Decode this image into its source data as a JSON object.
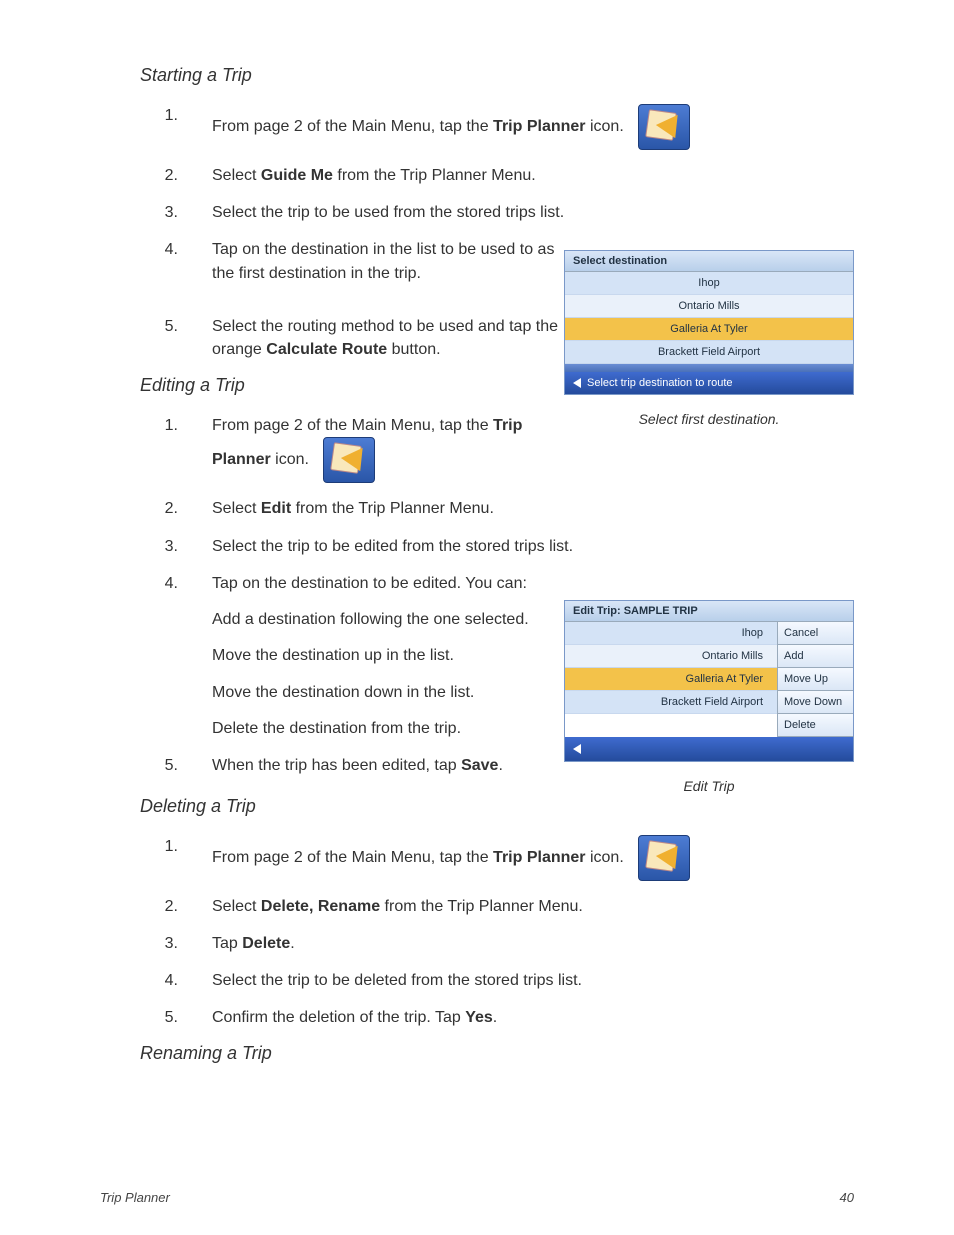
{
  "sections": {
    "starting": {
      "heading": "Starting a Trip",
      "steps": {
        "s1a": "From page 2 of the Main Menu, tap the ",
        "s1b": "Trip Planner",
        "s1c": " icon.",
        "s2a": "Select ",
        "s2b": "Guide Me",
        "s2c": " from the Trip Planner Menu.",
        "s3": "Select the trip to be used from the stored trips list.",
        "s4": "Tap on the destination in the list to be used to as the first destination in the trip.",
        "s5a": "Select the routing method to be used and tap the orange ",
        "s5b": "Calculate Route",
        "s5c": " button."
      }
    },
    "editing": {
      "heading": "Editing a Trip",
      "steps": {
        "s1a": "From page 2 of the Main Menu, tap the ",
        "s1b": "Trip Planner",
        "s1c": " icon.",
        "s2a": "Select ",
        "s2b": "Edit",
        "s2c": " from the Trip Planner Menu.",
        "s3": "Select the trip to be edited from the stored trips list.",
        "s4": "Tap on the destination to be edited.  You can:",
        "sub1": "Add a destination following the one selected.",
        "sub2": "Move the destination up in the list.",
        "sub3": "Move the destination down in the list.",
        "sub4": "Delete the destination from the trip.",
        "s5a": "When the trip has been edited, tap ",
        "s5b": "Save",
        "s5c": "."
      }
    },
    "deleting": {
      "heading": "Deleting a Trip",
      "steps": {
        "s1a": "From page 2 of the Main Menu, tap the ",
        "s1b": "Trip Planner",
        "s1c": " icon.",
        "s2a": "Select ",
        "s2b": "Delete, Rename",
        "s2c": " from the Trip Planner Menu.",
        "s3a": "Tap ",
        "s3b": "Delete",
        "s3c": ".",
        "s4": "Select the trip to be deleted from the stored trips list.",
        "s5a": "Confirm the deletion of the trip.  Tap ",
        "s5b": "Yes",
        "s5c": "."
      }
    },
    "renaming": {
      "heading": "Renaming a Trip"
    }
  },
  "numbers": {
    "n1": "1.",
    "n2": "2.",
    "n3": "3.",
    "n4": "4.",
    "n5": "5."
  },
  "screenshot1": {
    "header": "Select destination",
    "rows": [
      "Ihop",
      "Ontario Mills",
      "Galleria At Tyler",
      "Brackett Field Airport"
    ],
    "footer": "Select trip destination to route",
    "caption": "Select first destination."
  },
  "screenshot2": {
    "header": "Edit Trip: SAMPLE TRIP",
    "rows": [
      "Ihop",
      "Ontario Mills",
      "Galleria At Tyler",
      "Brackett Field Airport"
    ],
    "buttons": [
      "Cancel",
      "Add",
      "Move Up",
      "Move Down",
      "Delete"
    ],
    "caption": "Edit Trip"
  },
  "footer": {
    "left": "Trip Planner",
    "right": "40"
  }
}
